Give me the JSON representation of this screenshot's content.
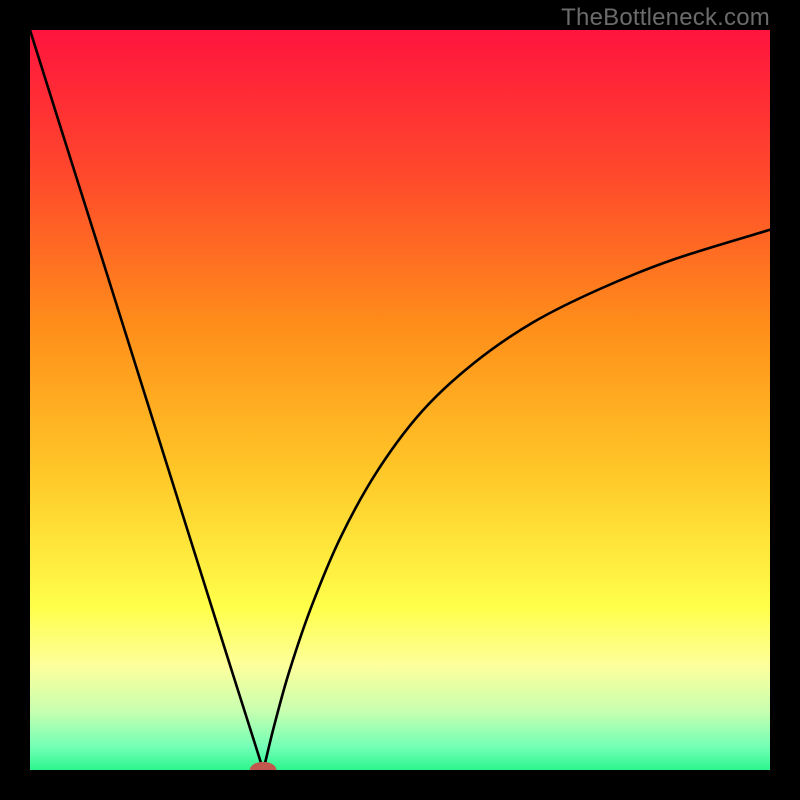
{
  "watermark": "TheBottleneck.com",
  "chart_data": {
    "type": "line",
    "title": "",
    "xlabel": "",
    "ylabel": "",
    "xlim": [
      0,
      100
    ],
    "ylim": [
      0,
      100
    ],
    "grid": false,
    "legend": false,
    "background_gradient": {
      "stops": [
        {
          "offset": 0.0,
          "color": "#ff143e"
        },
        {
          "offset": 0.2,
          "color": "#ff4a2b"
        },
        {
          "offset": 0.4,
          "color": "#ff8e1a"
        },
        {
          "offset": 0.6,
          "color": "#ffc828"
        },
        {
          "offset": 0.78,
          "color": "#ffff4a"
        },
        {
          "offset": 0.86,
          "color": "#fdff9c"
        },
        {
          "offset": 0.92,
          "color": "#c8ffb0"
        },
        {
          "offset": 0.97,
          "color": "#70ffb5"
        },
        {
          "offset": 1.0,
          "color": "#2cf58e"
        }
      ]
    },
    "curve": {
      "description": "V-shaped bottleneck curve with vertex at x≈31.5 reaching y=0, left branch steep linear to y=100 at x=0, right branch asymptotic rising toward y≈73 at x=100",
      "x": [
        0,
        5,
        10,
        15,
        20,
        25,
        28,
        30,
        31.2,
        31.5,
        31.8,
        33,
        35,
        38,
        42,
        47,
        53,
        60,
        68,
        77,
        87,
        100
      ],
      "y": [
        100,
        84.1,
        68.3,
        52.4,
        36.5,
        20.6,
        11.1,
        4.8,
        1.0,
        0,
        1.1,
        6.0,
        13.2,
        22.0,
        31.5,
        40.5,
        48.5,
        55.0,
        60.5,
        65.0,
        69.0,
        73.0
      ]
    },
    "marker": {
      "x": 31.5,
      "y": 0,
      "rx": 1.8,
      "ry": 1.1,
      "color": "#c0584e"
    }
  }
}
